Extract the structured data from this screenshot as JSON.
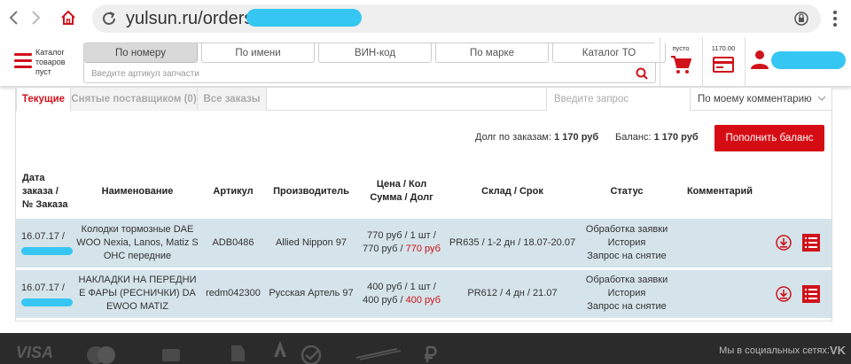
{
  "browser": {
    "url": "yulsun.ru/orders/"
  },
  "header": {
    "catalog_label": "Каталог товаров пуст",
    "search_tabs": [
      "По номеру",
      "По имени",
      "ВИН-код",
      "По марке",
      "Каталог ТО"
    ],
    "search_placeholder": "Введите артикул запчасти",
    "cart_label": "пусто",
    "balance_label": "1170.00"
  },
  "order_tabs": {
    "current": "Текущие",
    "removed": "Снятые поставщиком (0)",
    "all": "Все заказы",
    "query_placeholder": "Введите запрос",
    "sort_value": "По моему комментарию"
  },
  "summary": {
    "debt_label": "Долг по заказам:",
    "debt_value": "1 170  руб",
    "balance_label": "Баланс:",
    "balance_value": "1 170  руб",
    "topup_button": "Пополнить баланс"
  },
  "table": {
    "headers": {
      "date": "Дата заказа / № Заказа",
      "name": "Наименование",
      "article": "Артикул",
      "maker": "Производитель",
      "price_line1": "Цена / Кол",
      "price_line2": "Сумма / Долг",
      "stock": "Склад / Срок",
      "status": "Статус",
      "comment": "Комментарий"
    },
    "rows": [
      {
        "date": "16.07.17 /",
        "name": "Колодки тормозные DAE WOO Nexia, Lanos, Matiz S OHC передние",
        "article": "ADB0486",
        "maker": "Allied Nippon 97",
        "price_qty": "770 руб / 1 шт /",
        "sum": "770 руб /",
        "debt": "770 руб",
        "stock": "PR635 / 1-2 дн / 18.07-20.07",
        "status1": "Обработка заявки",
        "status2": "История",
        "status3": "Запрос на снятие"
      },
      {
        "date": "16.07.17 /",
        "name": "НАКЛАДКИ НА ПЕРЕДНИ Е ФАРЫ (РЕСНИЧКИ) DA EWOO MATIZ",
        "article": "redm042300",
        "maker": "Русская Артель 97",
        "price_qty": "400 руб / 1 шт /",
        "sum": "400 руб /",
        "debt": "400 руб",
        "stock": "PR612 / 4 дн / 21.07",
        "status1": "Обработка заявки",
        "status2": "История",
        "status3": "Запрос на снятие"
      }
    ]
  },
  "footer": {
    "visa": "VISA",
    "social_label": "Мы в социальных сетях:",
    "vk": "VK"
  },
  "colors": {
    "brand_red": "#d0121b",
    "row_bg": "#d5e3ea",
    "redaction": "#36c6f4"
  }
}
